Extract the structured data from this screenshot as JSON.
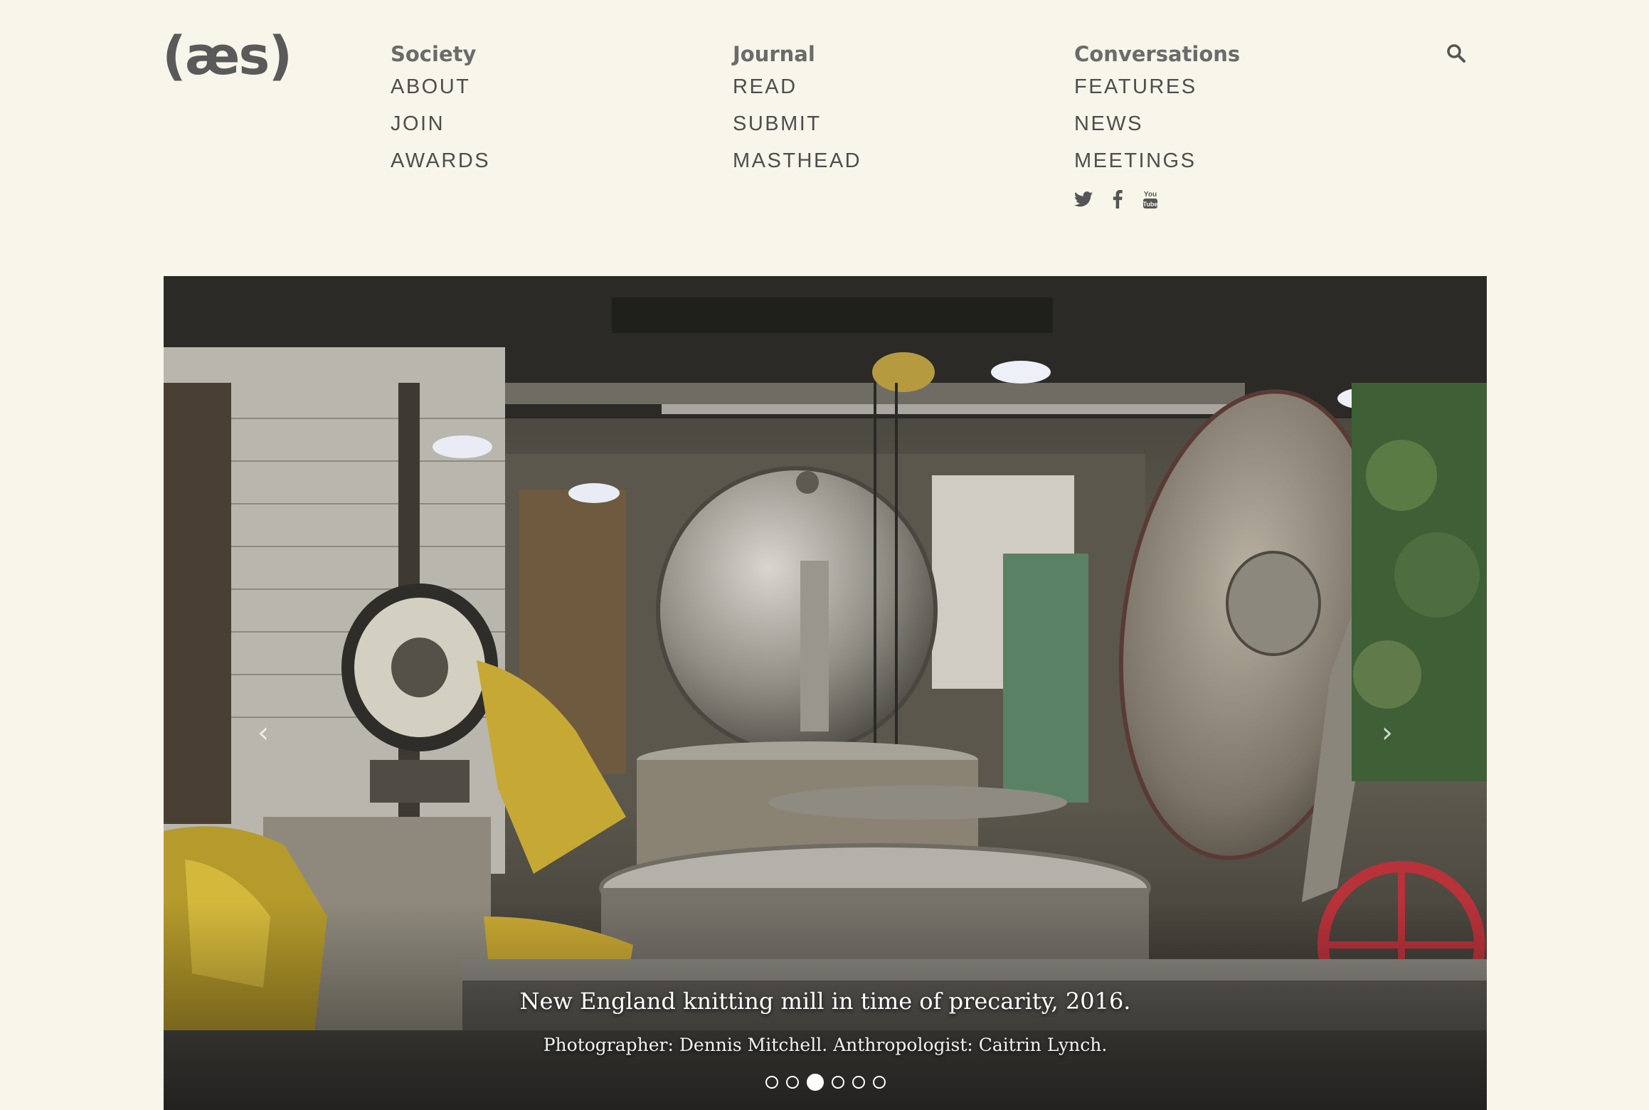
{
  "logo": {
    "text": "(æs)"
  },
  "nav": {
    "society": {
      "heading": "Society",
      "items": [
        "ABOUT",
        "JOIN",
        "AWARDS"
      ]
    },
    "journal": {
      "heading": "Journal",
      "items": [
        "READ",
        "SUBMIT",
        "MASTHEAD"
      ]
    },
    "conversations": {
      "heading": "Conversations",
      "items": [
        "FEATURES",
        "NEWS",
        "MEETINGS"
      ]
    },
    "social_icons": [
      "twitter-icon",
      "facebook-icon",
      "youtube-icon"
    ],
    "search_icon": "search-icon"
  },
  "hero": {
    "caption_title": "New England knitting mill in time of precarity, 2016.",
    "caption_sub": "Photographer: Dennis Mitchell. Anthropologist: Caitrin Lynch.",
    "slide_count": 6,
    "active_slide": 3,
    "prev_icon": "chevron-left-icon",
    "next_icon": "chevron-right-icon"
  },
  "colors": {
    "background": "#f8f5ea",
    "text": "#4e4e4e",
    "heading": "#6b6b6b"
  }
}
